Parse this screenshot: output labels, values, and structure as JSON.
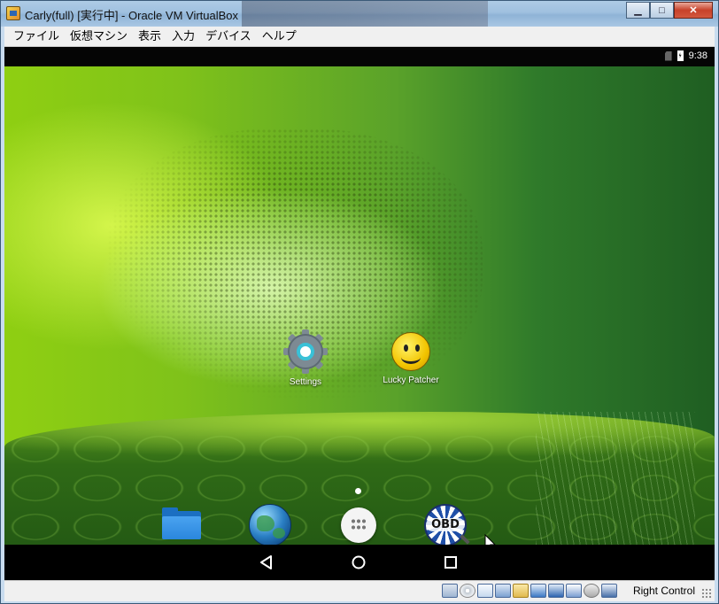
{
  "window": {
    "title": "Carly(full) [実行中] - Oracle VM VirtualBox",
    "minimize": "▁",
    "maximize": "□",
    "close": "✕"
  },
  "menu": [
    "ファイル",
    "仮想マシン",
    "表示",
    "入力",
    "デバイス",
    "ヘルプ"
  ],
  "android": {
    "status_time": "9:38",
    "apps": [
      {
        "label": "Settings",
        "icon": "settings-gear-icon"
      },
      {
        "label": "Lucky Patcher",
        "icon": "smiley-face-icon"
      }
    ],
    "dock": [
      "folder-icon",
      "globe-browser-icon",
      "app-drawer-icon",
      "obd-icon"
    ],
    "nav": [
      "back-icon",
      "home-icon",
      "recents-icon"
    ]
  },
  "statusbar": {
    "host_key": "Right Control",
    "icons": [
      "hard-disk-icon",
      "optical-drive-icon",
      "audio-icon",
      "usb-icon",
      "shared-folder-icon",
      "display-icon",
      "network-icon",
      "vt-x-icon",
      "mouse-integration-icon",
      "host-key-arrow-icon"
    ]
  },
  "colors": {
    "titlebar": "#9fc0df",
    "close_button": "#c7412a",
    "wallpaper_green": "#7fc21a",
    "android_nav": "#000000",
    "settings_accent": "#39c1d7"
  }
}
